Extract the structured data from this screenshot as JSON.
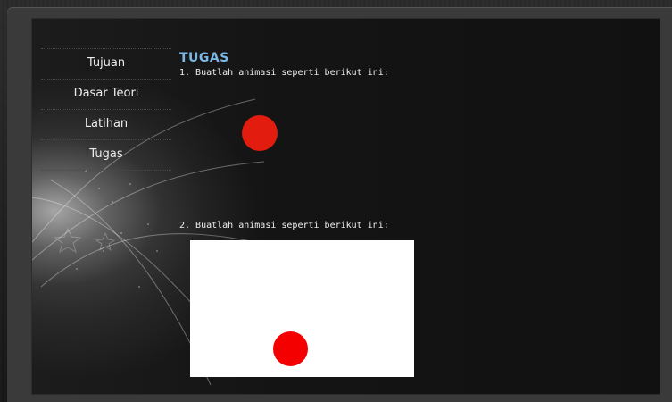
{
  "nav": {
    "items": [
      {
        "label": "Tujuan"
      },
      {
        "label": "Dasar Teori"
      },
      {
        "label": "Latihan"
      },
      {
        "label": "Tugas"
      }
    ]
  },
  "content": {
    "heading": "TUGAS",
    "tasks": [
      {
        "text": "1. Buatlah animasi seperti berikut ini:",
        "ball_color": "#e31c10"
      },
      {
        "text": "2. Buatlah animasi seperti berikut ini:",
        "ball_color": "#f40000",
        "canvas_color": "#ffffff"
      }
    ]
  },
  "theme": {
    "heading_color": "#7cb8e6",
    "text_color": "#f0f0f0",
    "background": "#141414"
  }
}
